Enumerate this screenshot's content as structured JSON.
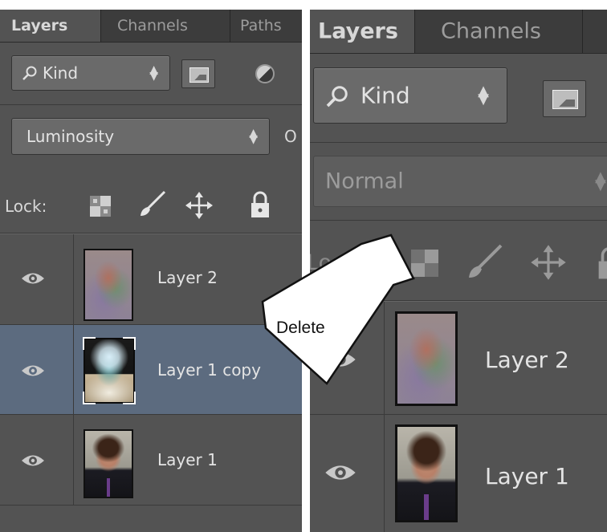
{
  "left_panel": {
    "tabs": [
      {
        "label": "Layers",
        "active": true
      },
      {
        "label": "Channels",
        "active": false
      },
      {
        "label": "Paths",
        "active": false
      }
    ],
    "filter": {
      "label": "Kind",
      "search_icon": "search-icon"
    },
    "blend_mode": "Luminosity",
    "opacity_label_fragment": "O",
    "lock_label": "Lock:",
    "layers": [
      {
        "name": "Layer 2",
        "visible": true,
        "selected": false
      },
      {
        "name": "Layer 1 copy",
        "visible": true,
        "selected": true
      },
      {
        "name": "Layer 1",
        "visible": true,
        "selected": false
      }
    ]
  },
  "right_panel": {
    "tabs": [
      {
        "label": "Layers",
        "active": true
      },
      {
        "label": "Channels",
        "active": false
      }
    ],
    "filter": {
      "label": "Kind"
    },
    "blend_mode": "Normal",
    "lock_label_fragment": "Lo",
    "layers": [
      {
        "name": "Layer 2",
        "visible": true
      },
      {
        "name": "Layer 1",
        "visible": true
      }
    ]
  },
  "annotation": {
    "label": "Delete"
  },
  "colors": {
    "panel_bg": "#535353",
    "tab_bar_bg": "#3c3c3c",
    "selected_row": "#5c6b7f",
    "text": "#e4e4e4"
  }
}
